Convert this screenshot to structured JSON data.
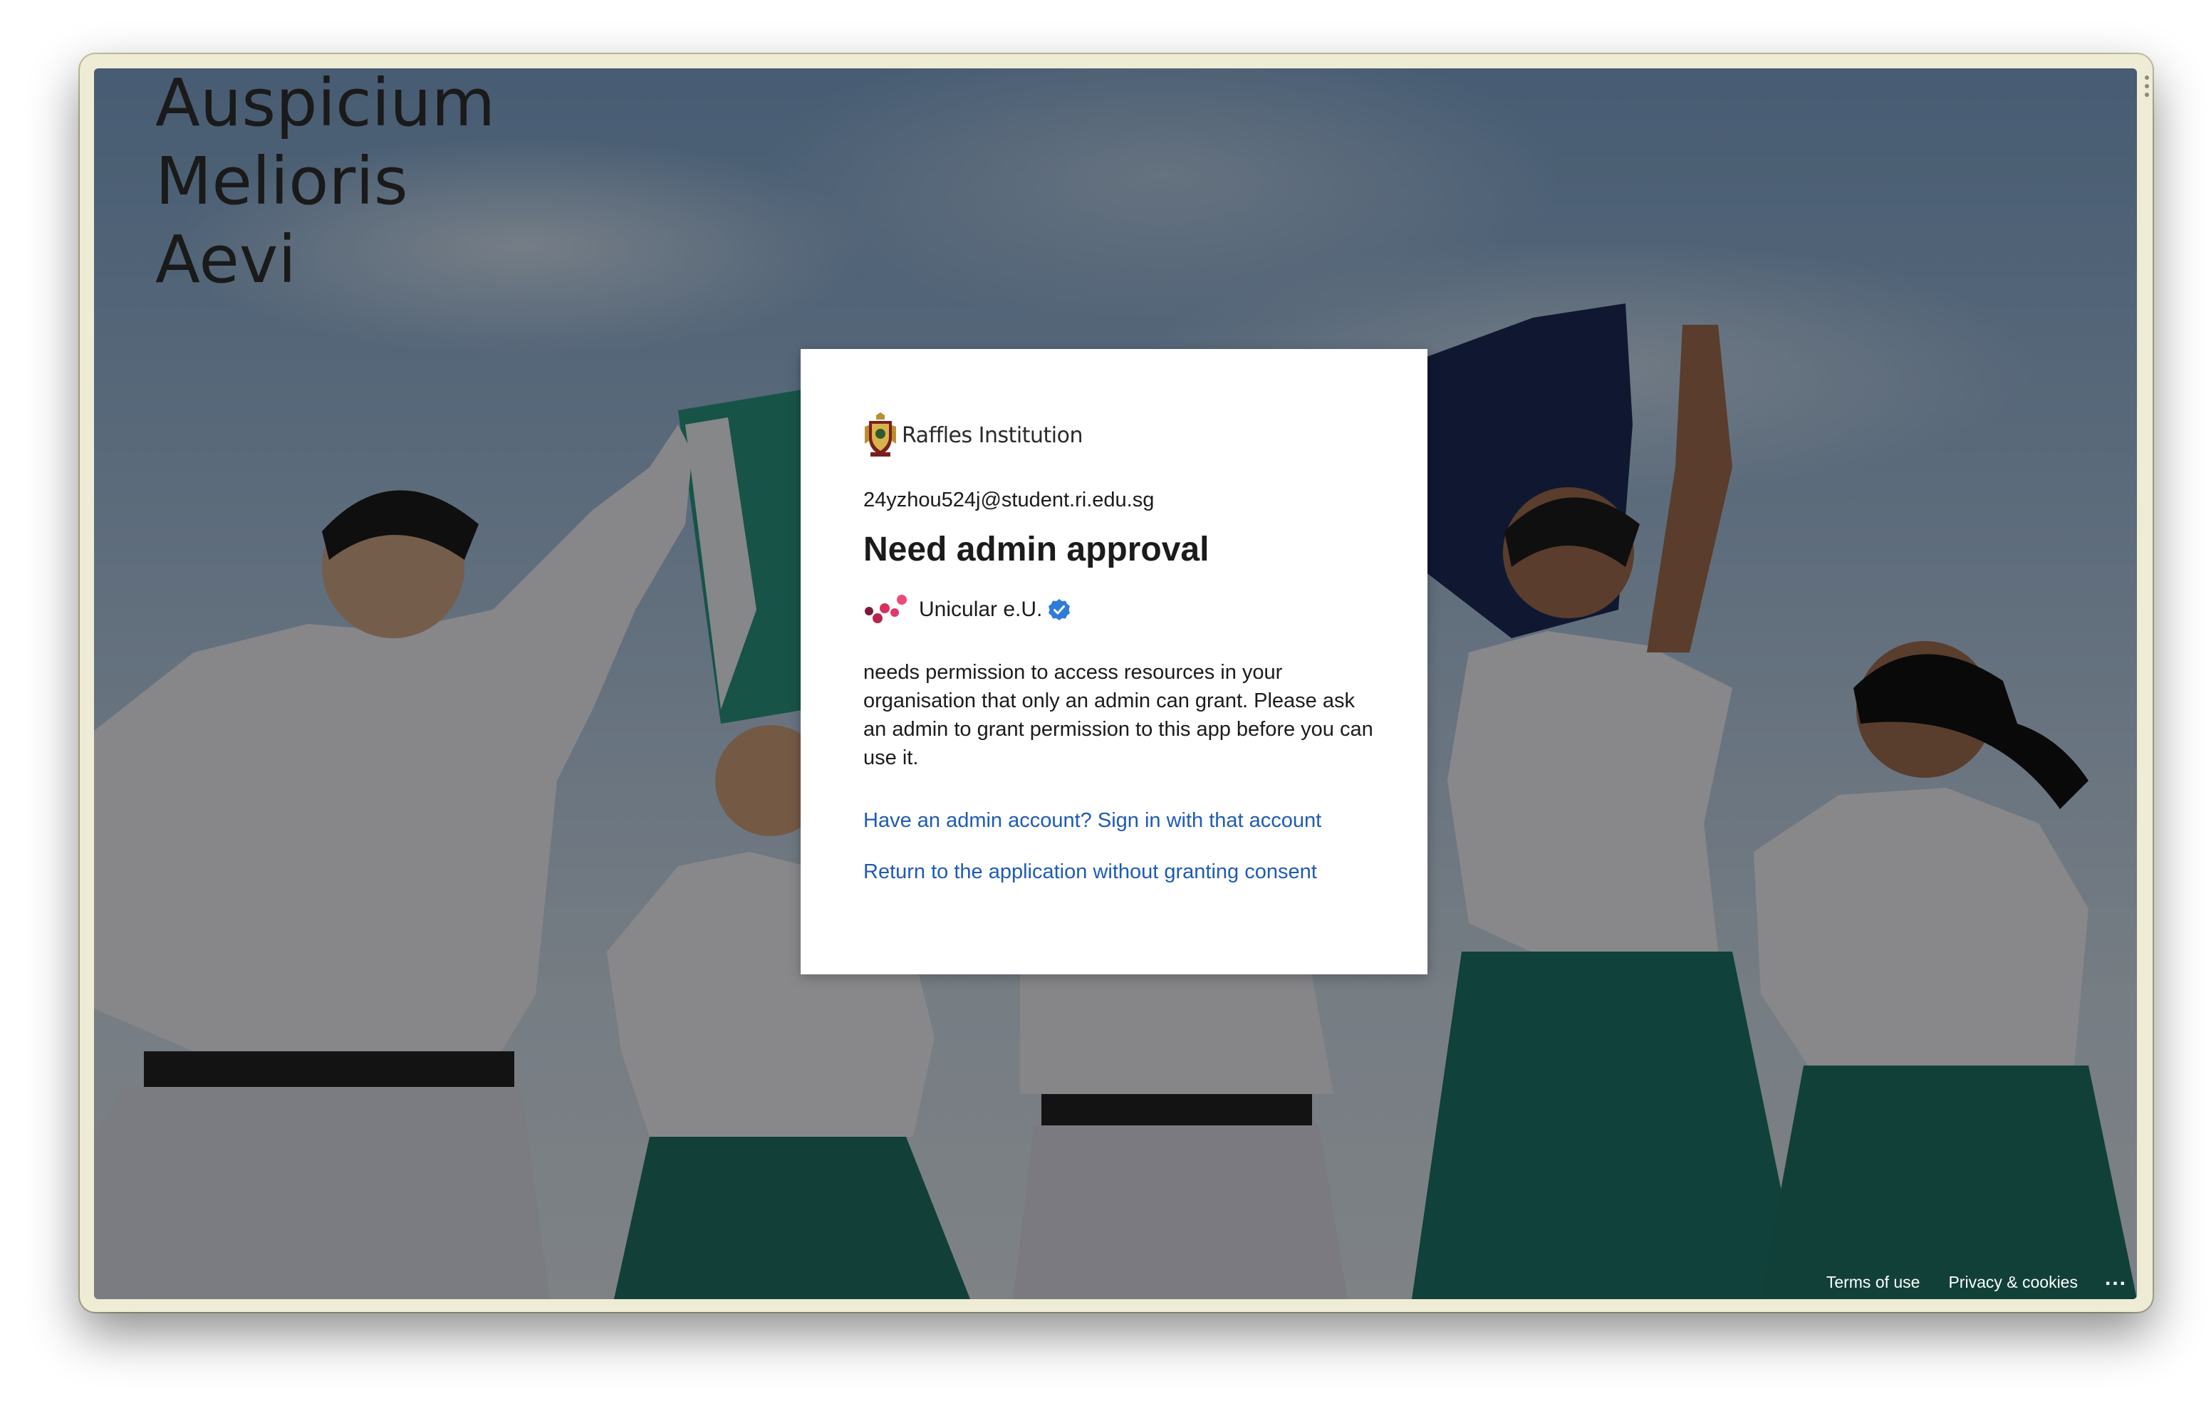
{
  "background": {
    "motto_lines": [
      "Auspicium",
      "Melioris",
      "Aevi"
    ]
  },
  "dialog": {
    "org_name": "Raffles Institution",
    "account": "24yzhou524j@student.ri.edu.sg",
    "title": "Need admin approval",
    "app_name": "Unicular e.U.",
    "app_verified": true,
    "message": "needs permission to access resources in your organisation that only an admin can grant. Please ask an admin to grant permission to this app before you can use it.",
    "links": [
      "Have an admin account? Sign in with that account",
      "Return to the application without granting consent"
    ],
    "link_color": "#1f5bb5"
  },
  "footer": {
    "terms": "Terms of use",
    "privacy": "Privacy & cookies",
    "more": "..."
  },
  "icons": {
    "org_logo": "raffles-crest-icon",
    "app_logo": "unicular-logo-icon",
    "verified": "verified-badge-icon",
    "more": "ellipsis-icon"
  }
}
